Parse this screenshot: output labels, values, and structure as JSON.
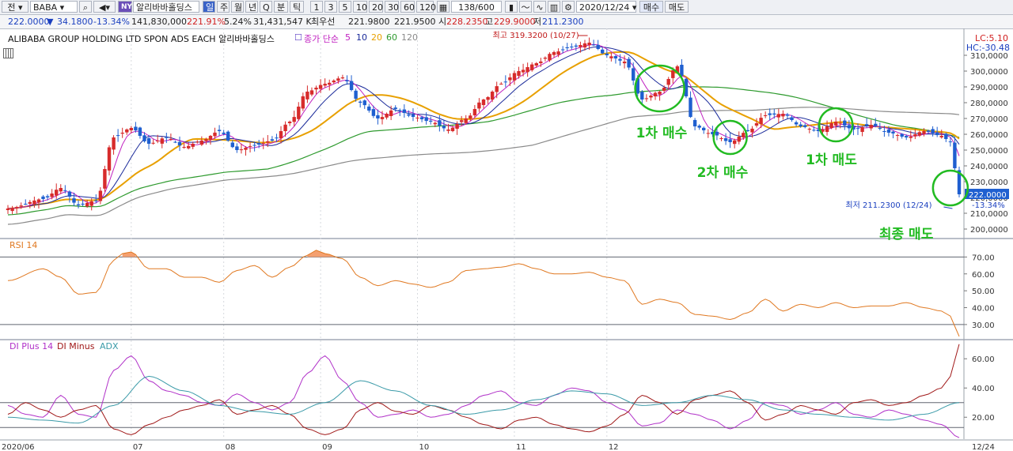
{
  "toolbar": {
    "market": "전",
    "ticker": "BABA",
    "exchange_badge": "NY",
    "name": "알리바바홀딩스",
    "periods": [
      "일",
      "주",
      "월",
      "년",
      "Q",
      "분",
      "틱"
    ],
    "intervals": [
      "1",
      "3",
      "5",
      "10",
      "20",
      "30",
      "60",
      "120"
    ],
    "count": "138/600",
    "date": "2020/12/24",
    "buy": "매수",
    "sell": "매도"
  },
  "quote": {
    "price": "222.0000",
    "change_arrow": "▼",
    "change": "34.1800",
    "change_pct": "-13.34%",
    "volume": "141,830,000",
    "volume_ratio": "221.91%",
    "turnover_pct": "5.24%",
    "amount": "31,431,547 K",
    "best_label": "최우선",
    "bid": "221.9800",
    "ask": "221.9500",
    "open_label": "시",
    "open": "228.2350",
    "high_label": "고",
    "high": "229.9000",
    "low_label": "저",
    "low": "211.2300"
  },
  "title": {
    "symbol_name": "ALIBABA GROUP HOLDING LTD SPON ADS EACH  알리바바홀딩스",
    "ma_label": "종가 단순",
    "ma_periods": [
      "5",
      "10",
      "20",
      "60",
      "120"
    ],
    "lc": "LC:5.10",
    "hc": "HC:-30.48"
  },
  "colors": {
    "up": "#d72b2b",
    "down": "#1f5fd0",
    "ma5": "#c020c0",
    "ma10": "#1a2a9a",
    "ma20": "#e8a000",
    "ma60": "#2e9a2e",
    "ma120": "#8a8a8a",
    "rsi": "#e07820",
    "di_plus": "#b030c8",
    "di_minus": "#a01818",
    "adx": "#3a9aa8",
    "annotation": "#22bb22"
  },
  "chart_data": [
    {
      "type": "candlestick",
      "name": "price",
      "x": [
        "2020/06",
        "07",
        "08",
        "09",
        "10",
        "11",
        "12",
        "12/24"
      ],
      "ylim": [
        195,
        322
      ],
      "yticks": [
        "310,0000",
        "300,0000",
        "290,0000",
        "280,0000",
        "270,0000",
        "260,0000",
        "250,0000",
        "240,0000",
        "230,0000",
        "220,0000",
        "210,0000",
        "200,0000"
      ],
      "last_label": "222.0000",
      "last_pct": "-13.34%",
      "high_note": "최고 319.3200 (10/27)",
      "low_note": "최저 211.2300 (12/24)",
      "anchors": [
        [
          0,
          213
        ],
        [
          8,
          219
        ],
        [
          12,
          226
        ],
        [
          16,
          215
        ],
        [
          20,
          218
        ],
        [
          24,
          258
        ],
        [
          28,
          264
        ],
        [
          32,
          254
        ],
        [
          36,
          258
        ],
        [
          40,
          252
        ],
        [
          44,
          256
        ],
        [
          48,
          262
        ],
        [
          52,
          250
        ],
        [
          56,
          253
        ],
        [
          60,
          256
        ],
        [
          64,
          268
        ],
        [
          68,
          287
        ],
        [
          72,
          292
        ],
        [
          76,
          296
        ],
        [
          80,
          280
        ],
        [
          84,
          270
        ],
        [
          88,
          276
        ],
        [
          92,
          271
        ],
        [
          96,
          268
        ],
        [
          100,
          263
        ],
        [
          104,
          270
        ],
        [
          108,
          282
        ],
        [
          112,
          292
        ],
        [
          116,
          300
        ],
        [
          120,
          305
        ],
        [
          124,
          312
        ],
        [
          128,
          315
        ],
        [
          132,
          318
        ],
        [
          136,
          310
        ],
        [
          140,
          306
        ],
        [
          144,
          282
        ],
        [
          148,
          287
        ],
        [
          152,
          303
        ],
        [
          156,
          265
        ],
        [
          160,
          260
        ],
        [
          164,
          255
        ],
        [
          168,
          262
        ],
        [
          172,
          272
        ],
        [
          176,
          273
        ],
        [
          180,
          265
        ],
        [
          184,
          262
        ],
        [
          188,
          268
        ],
        [
          192,
          263
        ],
        [
          196,
          266
        ],
        [
          200,
          261
        ],
        [
          204,
          258
        ],
        [
          208,
          262
        ],
        [
          212,
          259
        ],
        [
          214,
          255
        ],
        [
          216,
          222
        ]
      ],
      "series": [
        {
          "name": "5",
          "color": "#c020c0"
        },
        {
          "name": "10",
          "color": "#1a2a9a"
        },
        {
          "name": "20",
          "color": "#e8a000"
        },
        {
          "name": "60",
          "color": "#2e9a2e"
        },
        {
          "name": "120",
          "color": "#8a8a8a"
        }
      ]
    },
    {
      "type": "line",
      "name": "RSI 14",
      "ylim": [
        22,
        80
      ],
      "yticks": [
        "70.00",
        "60.00",
        "50.00",
        "40.00",
        "30.00"
      ],
      "guides": [
        70,
        30
      ],
      "anchors": [
        [
          0,
          56
        ],
        [
          8,
          63
        ],
        [
          12,
          58
        ],
        [
          16,
          48
        ],
        [
          20,
          49
        ],
        [
          24,
          68
        ],
        [
          26,
          72
        ],
        [
          28,
          73
        ],
        [
          32,
          63
        ],
        [
          36,
          63
        ],
        [
          40,
          58
        ],
        [
          44,
          58
        ],
        [
          48,
          55
        ],
        [
          52,
          62
        ],
        [
          56,
          65
        ],
        [
          60,
          58
        ],
        [
          64,
          64
        ],
        [
          68,
          71
        ],
        [
          70,
          74
        ],
        [
          72,
          72
        ],
        [
          76,
          69
        ],
        [
          80,
          58
        ],
        [
          84,
          53
        ],
        [
          88,
          56
        ],
        [
          92,
          54
        ],
        [
          96,
          52
        ],
        [
          100,
          55
        ],
        [
          104,
          62
        ],
        [
          108,
          63
        ],
        [
          112,
          64
        ],
        [
          116,
          66
        ],
        [
          120,
          63
        ],
        [
          124,
          60
        ],
        [
          128,
          60
        ],
        [
          132,
          61
        ],
        [
          136,
          58
        ],
        [
          140,
          56
        ],
        [
          144,
          42
        ],
        [
          148,
          45
        ],
        [
          152,
          43
        ],
        [
          156,
          36
        ],
        [
          160,
          35
        ],
        [
          164,
          33
        ],
        [
          168,
          37
        ],
        [
          172,
          45
        ],
        [
          176,
          38
        ],
        [
          180,
          42
        ],
        [
          184,
          40
        ],
        [
          188,
          43
        ],
        [
          192,
          40
        ],
        [
          196,
          41
        ],
        [
          200,
          41
        ],
        [
          204,
          43
        ],
        [
          208,
          40
        ],
        [
          212,
          38
        ],
        [
          214,
          35
        ],
        [
          216,
          23
        ]
      ]
    },
    {
      "type": "line",
      "name": "DMI",
      "ylim": [
        5,
        72
      ],
      "yticks": [
        "60.00",
        "40.00",
        "20.00"
      ],
      "guides": [
        30,
        13
      ],
      "series": [
        {
          "name": "DI Plus 14",
          "color": "#b030c8",
          "anchors": [
            [
              0,
              28
            ],
            [
              4,
              22
            ],
            [
              8,
              20
            ],
            [
              12,
              35
            ],
            [
              16,
              22
            ],
            [
              20,
              20
            ],
            [
              24,
              52
            ],
            [
              28,
              62
            ],
            [
              32,
              45
            ],
            [
              36,
              38
            ],
            [
              40,
              35
            ],
            [
              44,
              30
            ],
            [
              48,
              28
            ],
            [
              52,
              36
            ],
            [
              56,
              30
            ],
            [
              60,
              25
            ],
            [
              64,
              30
            ],
            [
              68,
              50
            ],
            [
              72,
              62
            ],
            [
              76,
              45
            ],
            [
              80,
              30
            ],
            [
              84,
              20
            ],
            [
              88,
              22
            ],
            [
              92,
              25
            ],
            [
              96,
              20
            ],
            [
              100,
              22
            ],
            [
              104,
              28
            ],
            [
              108,
              35
            ],
            [
              112,
              38
            ],
            [
              116,
              30
            ],
            [
              120,
              28
            ],
            [
              124,
              35
            ],
            [
              128,
              40
            ],
            [
              132,
              38
            ],
            [
              136,
              30
            ],
            [
              140,
              25
            ],
            [
              144,
              14
            ],
            [
              148,
              16
            ],
            [
              152,
              25
            ],
            [
              156,
              22
            ],
            [
              160,
              18
            ],
            [
              164,
              12
            ],
            [
              168,
              18
            ],
            [
              172,
              30
            ],
            [
              176,
              28
            ],
            [
              180,
              22
            ],
            [
              184,
              25
            ],
            [
              188,
              30
            ],
            [
              192,
              22
            ],
            [
              196,
              20
            ],
            [
              200,
              25
            ],
            [
              204,
              22
            ],
            [
              208,
              18
            ],
            [
              212,
              15
            ],
            [
              216,
              6
            ]
          ]
        },
        {
          "name": "DI Minus",
          "color": "#a01818",
          "anchors": [
            [
              0,
              22
            ],
            [
              4,
              30
            ],
            [
              8,
              25
            ],
            [
              12,
              20
            ],
            [
              16,
              25
            ],
            [
              20,
              28
            ],
            [
              24,
              12
            ],
            [
              28,
              8
            ],
            [
              32,
              15
            ],
            [
              36,
              20
            ],
            [
              40,
              25
            ],
            [
              44,
              28
            ],
            [
              48,
              32
            ],
            [
              52,
              22
            ],
            [
              56,
              25
            ],
            [
              60,
              28
            ],
            [
              64,
              22
            ],
            [
              68,
              12
            ],
            [
              72,
              8
            ],
            [
              76,
              12
            ],
            [
              80,
              25
            ],
            [
              84,
              30
            ],
            [
              88,
              24
            ],
            [
              92,
              22
            ],
            [
              96,
              28
            ],
            [
              100,
              25
            ],
            [
              104,
              20
            ],
            [
              108,
              15
            ],
            [
              112,
              12
            ],
            [
              116,
              18
            ],
            [
              120,
              20
            ],
            [
              124,
              15
            ],
            [
              128,
              12
            ],
            [
              132,
              10
            ],
            [
              136,
              14
            ],
            [
              140,
              22
            ],
            [
              144,
              35
            ],
            [
              148,
              30
            ],
            [
              152,
              22
            ],
            [
              156,
              32
            ],
            [
              160,
              35
            ],
            [
              164,
              38
            ],
            [
              168,
              30
            ],
            [
              172,
              18
            ],
            [
              176,
              22
            ],
            [
              180,
              28
            ],
            [
              184,
              25
            ],
            [
              188,
              22
            ],
            [
              192,
              30
            ],
            [
              196,
              32
            ],
            [
              200,
              28
            ],
            [
              204,
              30
            ],
            [
              208,
              35
            ],
            [
              212,
              40
            ],
            [
              214,
              48
            ],
            [
              216,
              70
            ]
          ]
        },
        {
          "name": "ADX",
          "color": "#3a9aa8",
          "anchors": [
            [
              0,
              20
            ],
            [
              8,
              18
            ],
            [
              16,
              16
            ],
            [
              24,
              28
            ],
            [
              32,
              48
            ],
            [
              40,
              38
            ],
            [
              48,
              28
            ],
            [
              56,
              24
            ],
            [
              64,
              22
            ],
            [
              72,
              30
            ],
            [
              80,
              45
            ],
            [
              88,
              38
            ],
            [
              96,
              28
            ],
            [
              104,
              22
            ],
            [
              112,
              25
            ],
            [
              120,
              32
            ],
            [
              128,
              38
            ],
            [
              136,
              36
            ],
            [
              144,
              28
            ],
            [
              152,
              30
            ],
            [
              160,
              35
            ],
            [
              168,
              32
            ],
            [
              176,
              25
            ],
            [
              184,
              22
            ],
            [
              192,
              20
            ],
            [
              200,
              18
            ],
            [
              208,
              22
            ],
            [
              216,
              30
            ]
          ]
        }
      ]
    }
  ],
  "annotations": [
    {
      "label": "1차 매수",
      "bar": 148,
      "price": 289
    },
    {
      "label": "2차 매수",
      "bar": 164,
      "price": 258
    },
    {
      "label": "1차 매도",
      "bar": 188,
      "price": 266
    },
    {
      "label": "최종 매도",
      "bar": 214,
      "price": 226
    }
  ]
}
